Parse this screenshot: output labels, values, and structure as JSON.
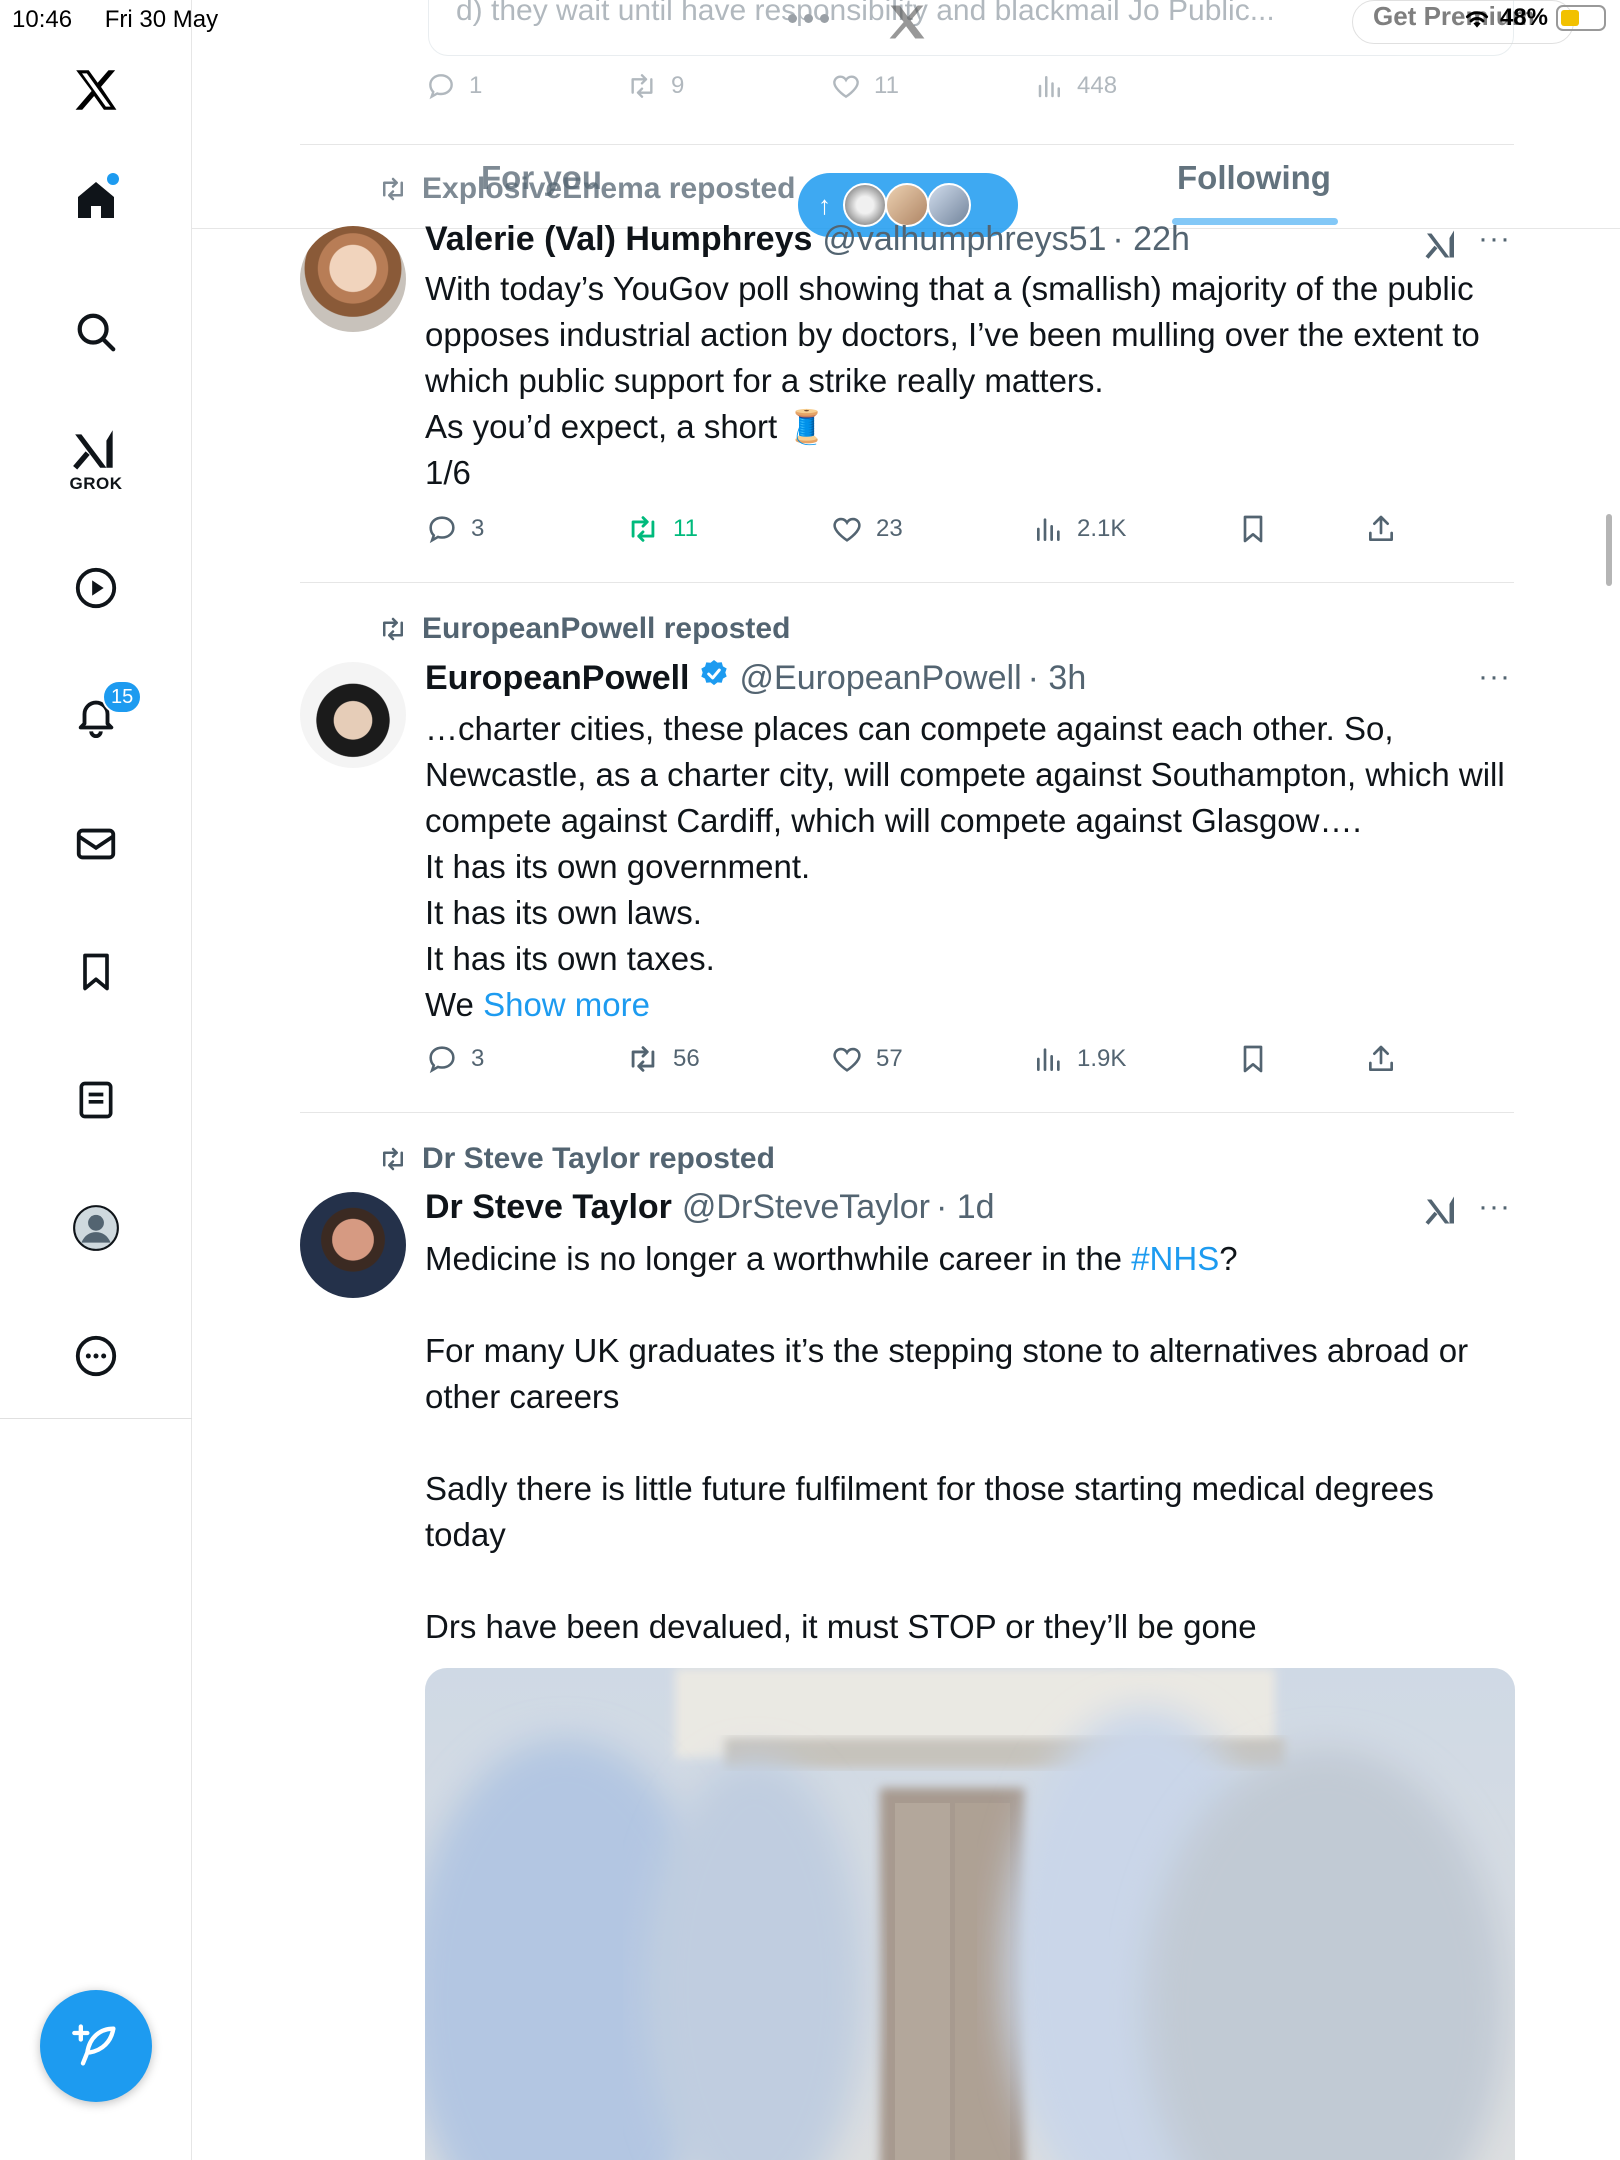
{
  "status_bar": {
    "time": "10:46",
    "date": "Fri 30 May",
    "battery": "48%"
  },
  "header": {
    "ghost_text": "d) they wait until have responsibility and blackmail Jo Public...",
    "get_premium": "Get Premium",
    "tabs": [
      {
        "label": "For you"
      },
      {
        "label": "Following"
      }
    ],
    "ghost_actions": {
      "replies": "1",
      "reposts": "9",
      "likes": "11",
      "views": "448"
    }
  },
  "sidebar": {
    "grok_label": "GROK",
    "notifications_count": "15"
  },
  "tweets": [
    {
      "repost_by": "ExplosiveEnema reposted",
      "name": "Valerie (Val) Humphreys",
      "handle": "@valhumphreys51",
      "time": "· 22h",
      "body": [
        "With today’s YouGov poll showing that a (smallish) majority of the public opposes industrial action by doctors, I’ve been mulling over the extent to which public support for a strike really matters.",
        "As you’d expect, a short 🧵",
        "1/6"
      ],
      "replies": "3",
      "reposts": "11",
      "likes": "23",
      "views": "2.1K"
    },
    {
      "repost_by": "EuropeanPowell reposted",
      "name": "EuropeanPowell",
      "handle": "@EuropeanPowell",
      "time": "· 3h",
      "body": [
        "…charter cities, these places can compete against each other. So, Newcastle, as a charter city, will compete against Southampton, which will compete against Cardiff, which will compete against Glasgow….",
        "It has its own government.",
        "It has its own laws.",
        "It has its own taxes."
      ],
      "body_last_prefix": "We",
      "show_more": "Show more",
      "replies": "3",
      "reposts": "56",
      "likes": "57",
      "views": "1.9K"
    },
    {
      "repost_by": "Dr Steve Taylor reposted",
      "name": "Dr Steve Taylor",
      "handle": "@DrSteveTaylor",
      "time": "· 1d",
      "body_first_prefix": "Medicine is no longer a worthwhile career in the",
      "hashtag": "#NHS",
      "body_first_suffix": "?",
      "body": [
        "For many UK graduates it’s the stepping stone to alternatives abroad or other careers",
        "Sadly there is little future fulfilment for those starting medical degrees today",
        "Drs have been devalued, it must STOP or they’ll be gone"
      ]
    }
  ]
}
